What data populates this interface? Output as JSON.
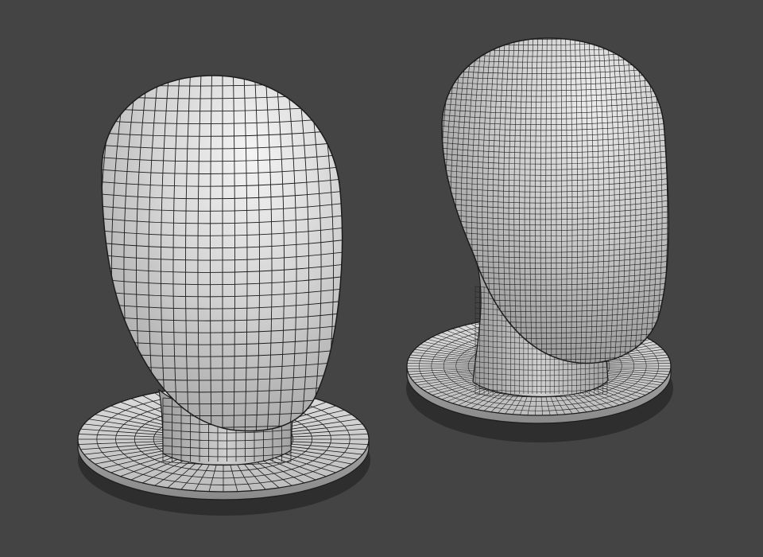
{
  "scene": {
    "background_color": "#444444",
    "surface_color": "#d4d4d4",
    "wire_color": "#1c1c1c",
    "objects": [
      {
        "name": "mannequin-head-coarse-mesh",
        "mesh_density": "low"
      },
      {
        "name": "mannequin-head-dense-mesh",
        "mesh_density": "high"
      }
    ]
  }
}
